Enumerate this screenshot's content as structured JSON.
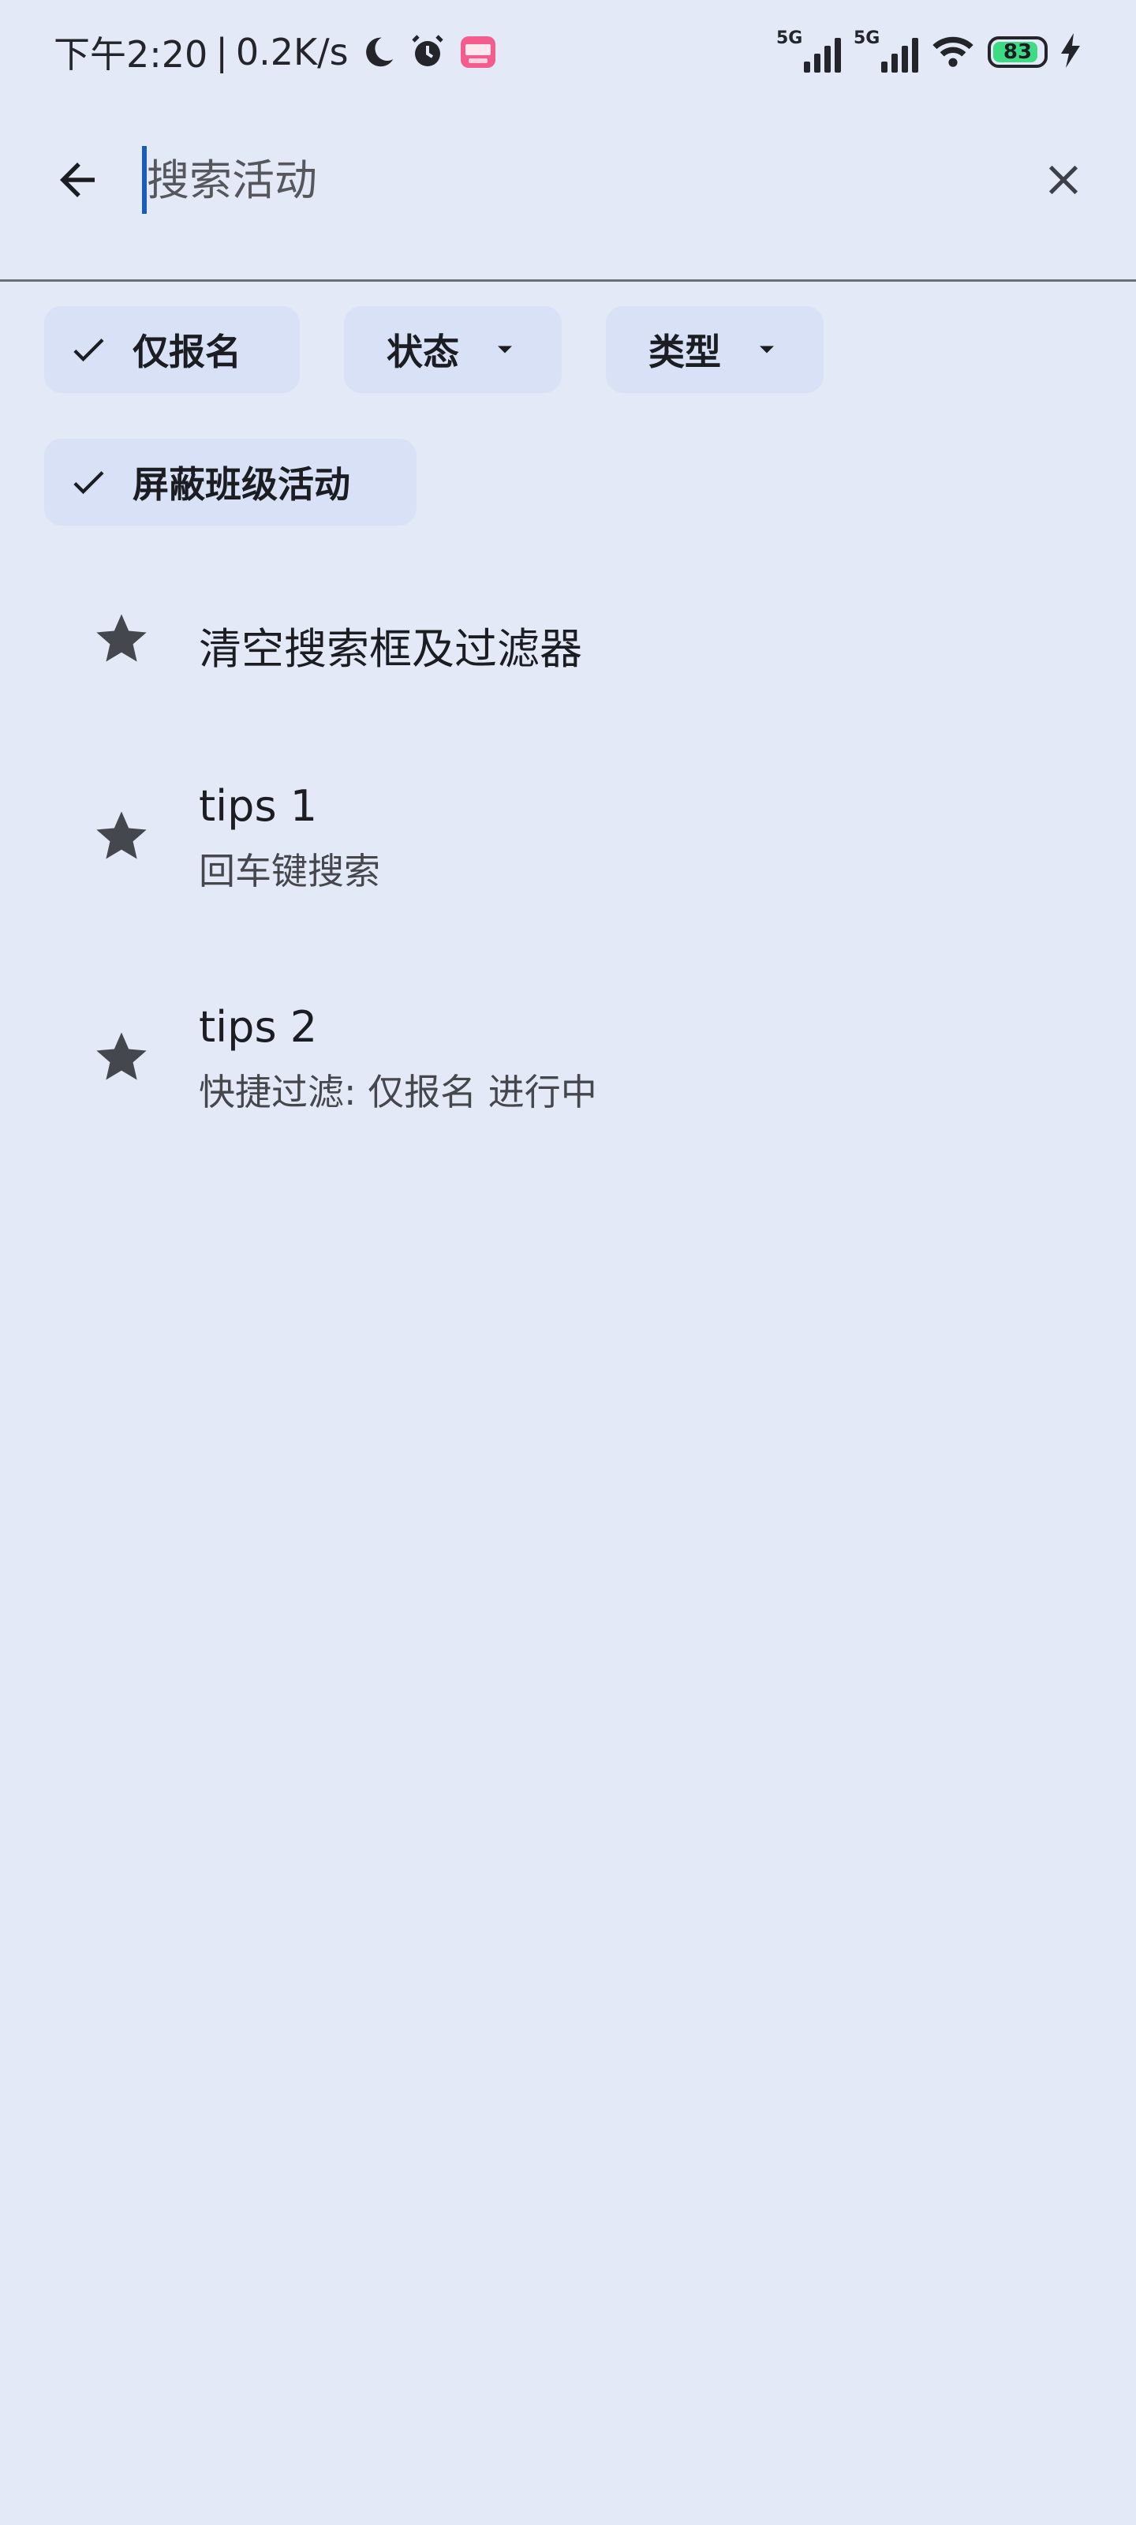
{
  "status_bar": {
    "time": "下午2:20",
    "separator": "|",
    "net_speed": "0.2K/s",
    "network_1": "5G",
    "network_2": "5G",
    "battery": "83",
    "icons": [
      "moon-icon",
      "alarm-icon",
      "bilibili-icon",
      "signal-icon",
      "wifi-icon",
      "battery-icon",
      "charging-icon"
    ]
  },
  "search": {
    "placeholder": "搜索活动",
    "value": ""
  },
  "filters": {
    "chips": [
      {
        "label": "仅报名",
        "checked": true
      },
      {
        "label": "状态",
        "dropdown": true
      },
      {
        "label": "类型",
        "dropdown": true
      },
      {
        "label": "屏蔽班级活动",
        "checked": true
      }
    ]
  },
  "suggestions": [
    {
      "title": "清空搜索框及过滤器",
      "subtitle": ""
    },
    {
      "title": "tips 1",
      "subtitle": "回车键搜索"
    },
    {
      "title": "tips 2",
      "subtitle": "快捷过滤: 仅报名 进行中"
    }
  ],
  "colors": {
    "background": "#e3e9f6",
    "chip": "#d9e1f6",
    "caret": "#1a5db8",
    "battery_fill": "#3ddc84"
  }
}
